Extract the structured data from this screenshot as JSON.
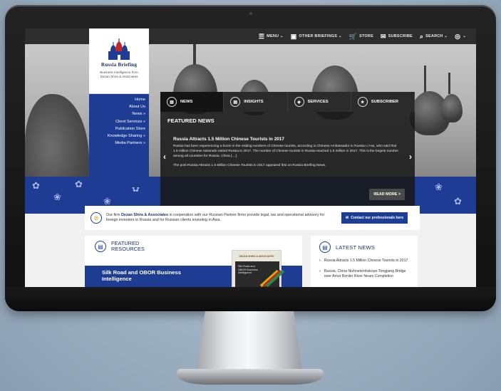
{
  "topbar": {
    "items": [
      {
        "icon": "menu-icon",
        "glyph": "☰",
        "label": "MENU ⌄"
      },
      {
        "icon": "briefings-icon",
        "glyph": "▣",
        "label": "OTHER BRIEFINGS ⌄"
      },
      {
        "icon": "cart-icon",
        "glyph": "🛒",
        "label": "STORE"
      },
      {
        "icon": "mail-icon",
        "glyph": "✉",
        "label": "SUBSCRIBE"
      },
      {
        "icon": "search-icon",
        "glyph": "⌕",
        "label": "SEARCH ⌄"
      },
      {
        "icon": "globe-icon",
        "glyph": "◎",
        "label": "⌄"
      }
    ]
  },
  "logo": {
    "title": "Russia Briefing",
    "subtitle_line1": "Business Intelligence from",
    "subtitle_line2": "Dezan Shira & Associates"
  },
  "sidenav": {
    "items": [
      "Home",
      "About Us",
      "News »",
      "Client Services »",
      "Publication Store",
      "Knowledge Sharing »",
      "Media Partners »"
    ]
  },
  "featured": {
    "tabs": [
      {
        "label": "NEWS",
        "glyph": "▤",
        "icon": "news-icon"
      },
      {
        "label": "INSIGHTS",
        "glyph": "▤",
        "icon": "insights-icon"
      },
      {
        "label": "SERVICES",
        "glyph": "◈",
        "icon": "services-icon"
      },
      {
        "label": "SUBSCRIBER",
        "glyph": "★",
        "icon": "subscriber-icon"
      }
    ],
    "heading": "FEATURED NEWS",
    "title": "Russia Attracts 1.5 Million Chinese Tourists in 2017",
    "body": "Russia has been experiencing a boom in the visiting numbers of Chinese tourists, according to Chinese Ambassador to Russia Li Hui, who said that 1.5 million Chinese nationals visited Russia in 2017. The number of Chinese tourists in Russia reached 1.5 million in 2017. This is the largest number among all countries for Russia. China [....]",
    "post_line": "The post Russia Attracts 1.5 Million Chinese Tourists in 2017 appeared first on Russia Briefing News.",
    "read_more": "READ MORE >",
    "prev_glyph": "‹",
    "next_glyph": "›"
  },
  "firm": {
    "text_pre": "Our firm ",
    "firm_name": "Dezan Shira & Associates",
    "text_post": " in cooperation with our Russian Partner firms provide legal, tax and operational advisory for foreign investors in Russia and for Russian clients investing in Asia.",
    "contact_label": "Contact our professionals here"
  },
  "resources": {
    "title_line1": "FEATURED",
    "title_line2": "RESOURCES",
    "banner_line1": "Silk Road and OBOR Business",
    "banner_line2": "Intelligence",
    "book_publisher": "DEZAN SHIRA & ASSOCIATES",
    "book_title": "Silk Road and OBOR Business Intelligence"
  },
  "latest_news": {
    "title": "LATEST NEWS",
    "items": [
      "Russia Attracts 1.5 Million Chinese Tourists in 2017",
      "Russia, China Nizhneleninskoye-Tongjiang Bridge over Amur Border River Nears Completion"
    ]
  },
  "colors": {
    "brand_blue": "#1f3c94",
    "topbar": "#2d2d2d"
  }
}
